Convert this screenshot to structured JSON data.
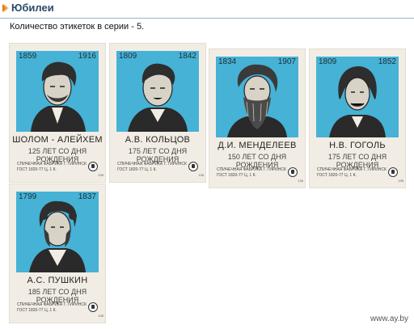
{
  "header": {
    "title": "Юбилеи"
  },
  "subtitle": "Количество этикеток в серии - 5.",
  "labels": [
    {
      "born": "1859",
      "died": "1916",
      "name": "ШОЛОМ - АЛЕЙХЕМ",
      "anniversary": "125 ЛЕТ СО ДНЯ РОЖДЕНИЯ",
      "factory": "СПИЧЕЧНАЯ ФАБРИКА Г. ГИРИНСК",
      "gost": "ГОСТ 1820-77 Ц. 1 К.",
      "code": "135"
    },
    {
      "born": "1809",
      "died": "1842",
      "name": "А.В. КОЛЬЦОВ",
      "anniversary": "175 ЛЕТ СО ДНЯ РОЖДЕНИЯ",
      "factory": "СПИЧЕЧНАЯ ФАБРИКА Г. ГИРИНСК",
      "gost": "ГОСТ 1820-77 Ц. 1 К.",
      "code": "135"
    },
    {
      "born": "1834",
      "died": "1907",
      "name": "Д.И. МЕНДЕЛЕЕВ",
      "anniversary": "150 ЛЕТ СО ДНЯ РОЖДЕНИЯ",
      "factory": "СПИЧЕЧНАЯ ФАБРИКА Г. ГИРИНСК",
      "gost": "ГОСТ 1820-77 Ц. 1 К.",
      "code": "135"
    },
    {
      "born": "1809",
      "died": "1852",
      "name": "Н.В. ГОГОЛЬ",
      "anniversary": "175 ЛЕТ СО ДНЯ РОЖДЕНИЯ",
      "factory": "СПИЧЕЧНАЯ ФАБРИКА Г. ГИРИНСК",
      "gost": "ГОСТ 1820-77 Ц. 1 К.",
      "code": "135"
    },
    {
      "born": "1799",
      "died": "1837",
      "name": "А.С. ПУШКИН",
      "anniversary": "185 ЛЕТ СО ДНЯ РОЖДЕНИЯ",
      "factory": "СПИЧЕЧНАЯ ФАБРИКА Г. ГИРИНСК",
      "gost": "ГОСТ 1820-77 Ц. 1 К.",
      "code": "135"
    }
  ],
  "colors": {
    "label_blue": "#45b2d6",
    "paper": "#f2ede4",
    "header_text": "#2b4a6b",
    "arrow": "#e07a10"
  },
  "watermark": "www.ay.by"
}
